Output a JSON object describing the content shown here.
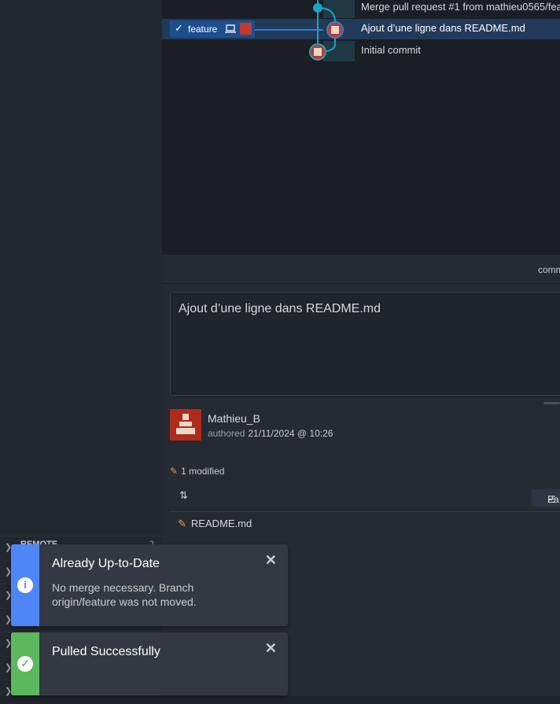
{
  "graph": {
    "commits": [
      {
        "message": "Merge pull request #1 from mathieu0565/fea",
        "selected": false
      },
      {
        "message": "Ajout d’une ligne dans README.md",
        "selected": true
      },
      {
        "message": "Initial commit",
        "selected": false
      }
    ],
    "branch_tag": {
      "name": "feature",
      "check": "✓"
    }
  },
  "detail": {
    "header_label": "comm",
    "message": "Ajout d’une ligne dans README.md",
    "author": "Mathieu_B",
    "authored_label": "authored",
    "authored_date": "21/11/2024 @ 10:26",
    "modified_count": "1 modified",
    "path_button": "Pa",
    "files": [
      {
        "name": "README.md"
      }
    ]
  },
  "left_panel": {
    "rows": [
      {
        "label": "REMOTE",
        "count": "2"
      },
      {
        "label": "",
        "count": ""
      },
      {
        "label": "",
        "count": ""
      },
      {
        "label": "",
        "count": ""
      },
      {
        "label": "",
        "count": ""
      },
      {
        "label": "",
        "count": ""
      },
      {
        "label": "",
        "count": ""
      }
    ]
  },
  "toasts": [
    {
      "title": "Already Up-to-Date",
      "body": "No merge necessary. Branch origin/feature was not moved.",
      "color": "#4f86f7",
      "icon": "info-icon"
    },
    {
      "title": "Pulled Successfully",
      "body": "",
      "color": "#5cb85c",
      "icon": "check-circle-icon"
    }
  ]
}
